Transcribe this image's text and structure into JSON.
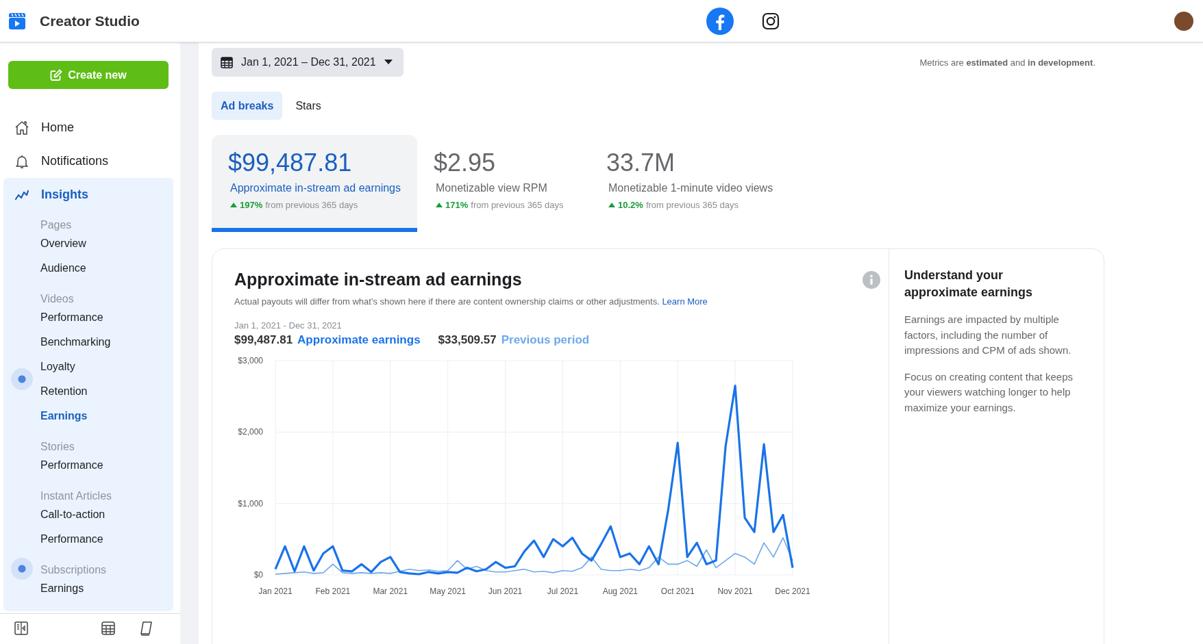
{
  "header": {
    "title": "Creator Studio",
    "platforms": [
      {
        "kind": "facebook",
        "selected": true
      },
      {
        "kind": "instagram",
        "selected": false
      }
    ]
  },
  "sidebar": {
    "create_button": "Create new",
    "items": [
      {
        "kind": "home",
        "label": "Home",
        "selected": false
      },
      {
        "kind": "bell",
        "label": "Notifications",
        "selected": false
      },
      {
        "kind": "insights",
        "label": "Insights",
        "selected": true,
        "groups": [
          {
            "heading": "Pages",
            "hint": false,
            "links": [
              {
                "label": "Overview",
                "selected": false,
                "hint": false
              },
              {
                "label": "Audience",
                "selected": false,
                "hint": false
              }
            ]
          },
          {
            "heading": "Videos",
            "hint": false,
            "links": [
              {
                "label": "Performance",
                "selected": false,
                "hint": false
              },
              {
                "label": "Benchmarking",
                "selected": false,
                "hint": false
              },
              {
                "label": "Loyalty",
                "selected": false,
                "hint": true
              },
              {
                "label": "Retention",
                "selected": false,
                "hint": false
              },
              {
                "label": "Earnings",
                "selected": true,
                "hint": false
              }
            ]
          },
          {
            "heading": "Stories",
            "hint": false,
            "links": [
              {
                "label": "Performance",
                "selected": false,
                "hint": false
              }
            ]
          },
          {
            "heading": "Instant Articles",
            "hint": false,
            "links": [
              {
                "label": "Call-to-action",
                "selected": false,
                "hint": false
              },
              {
                "label": "Performance",
                "selected": false,
                "hint": false
              }
            ]
          },
          {
            "heading": "Subscriptions",
            "hint": true,
            "links": [
              {
                "label": "Earnings",
                "selected": false,
                "hint": false
              }
            ]
          }
        ]
      }
    ]
  },
  "date_range": "Jan 1, 2021 – Dec 31, 2021",
  "metrics_note": "Metrics are **estimated** and **in development**.",
  "tabs": [
    {
      "label": "Ad breaks",
      "selected": true
    },
    {
      "label": "Stars",
      "selected": false
    }
  ],
  "metrics": [
    {
      "value": "$99,487.81",
      "label": "Approximate in-stream ad earnings",
      "change": "197%",
      "change_text": "from previous 365 days",
      "selected": true
    },
    {
      "value": "$2.95",
      "label": "Monetizable view RPM",
      "change": "171%",
      "change_text": "from previous 365 days",
      "selected": false
    },
    {
      "value": "33.7M",
      "label": "Monetizable 1-minute video views",
      "change": "10.2%",
      "change_text": "from previous 365 days",
      "selected": false
    }
  ],
  "earnings_card": {
    "title": "Approximate in-stream ad earnings",
    "description": "Actual payouts will differ from what's shown here if there are content ownership claims or other adjustments.",
    "learn_more": "Learn More",
    "period": "Jan 1, 2021 - Dec 31, 2021",
    "legend_amounts": [
      "$99,487.81",
      "$33,509.57"
    ],
    "chart_data": {
      "type": "line",
      "categories": [
        "Jan 2021",
        null,
        null,
        null,
        null,
        null,
        "Feb 2021",
        null,
        null,
        null,
        null,
        null,
        "Mar 2021",
        null,
        null,
        null,
        null,
        null,
        "May 2021",
        null,
        null,
        null,
        null,
        null,
        "Jun 2021",
        null,
        null,
        null,
        null,
        null,
        "Jul 2021",
        null,
        null,
        null,
        null,
        null,
        "Aug 2021",
        null,
        null,
        null,
        null,
        null,
        "Oct 2021",
        null,
        null,
        null,
        null,
        null,
        "Nov 2021",
        null,
        null,
        null,
        null,
        null,
        "Dec 2021"
      ],
      "series": [
        {
          "name": "Approximate earnings",
          "color": "#1a73e8",
          "values": [
            80,
            400,
            50,
            400,
            60,
            300,
            400,
            60,
            50,
            150,
            40,
            180,
            250,
            40,
            20,
            10,
            40,
            20,
            40,
            30,
            100,
            50,
            80,
            180,
            100,
            120,
            330,
            480,
            250,
            500,
            400,
            520,
            300,
            200,
            430,
            680,
            250,
            300,
            150,
            400,
            150,
            900,
            1850,
            250,
            450,
            150,
            200,
            1800,
            2650,
            800,
            600,
            1830,
            600,
            840,
            100
          ]
        },
        {
          "name": "Previous period",
          "color": "#6ea8ea",
          "values": [
            10,
            20,
            30,
            40,
            20,
            30,
            150,
            30,
            20,
            30,
            20,
            30,
            20,
            50,
            80,
            60,
            70,
            50,
            60,
            200,
            80,
            120,
            60,
            40,
            40,
            60,
            80,
            40,
            50,
            30,
            60,
            50,
            100,
            250,
            80,
            60,
            60,
            80,
            60,
            100,
            250,
            150,
            150,
            200,
            120,
            350,
            100,
            200,
            300,
            250,
            150,
            450,
            250,
            520,
            200
          ]
        }
      ],
      "ylim": [
        0,
        3000
      ],
      "grid": true,
      "yticks": [
        {
          "value": 0,
          "label": "$0"
        },
        {
          "value": 1000,
          "label": "$1,000"
        },
        {
          "value": 2000,
          "label": "$2,000"
        },
        {
          "value": 3000,
          "label": "$3,000"
        }
      ]
    }
  },
  "side_panel": {
    "title": "Understand your approximate earnings",
    "paragraphs": [
      "Earnings are impacted by multiple factors, including the number of impressions and CPM of ads shown.",
      "Focus on creating content that keeps your viewers watching longer to help maximize your earnings."
    ]
  }
}
